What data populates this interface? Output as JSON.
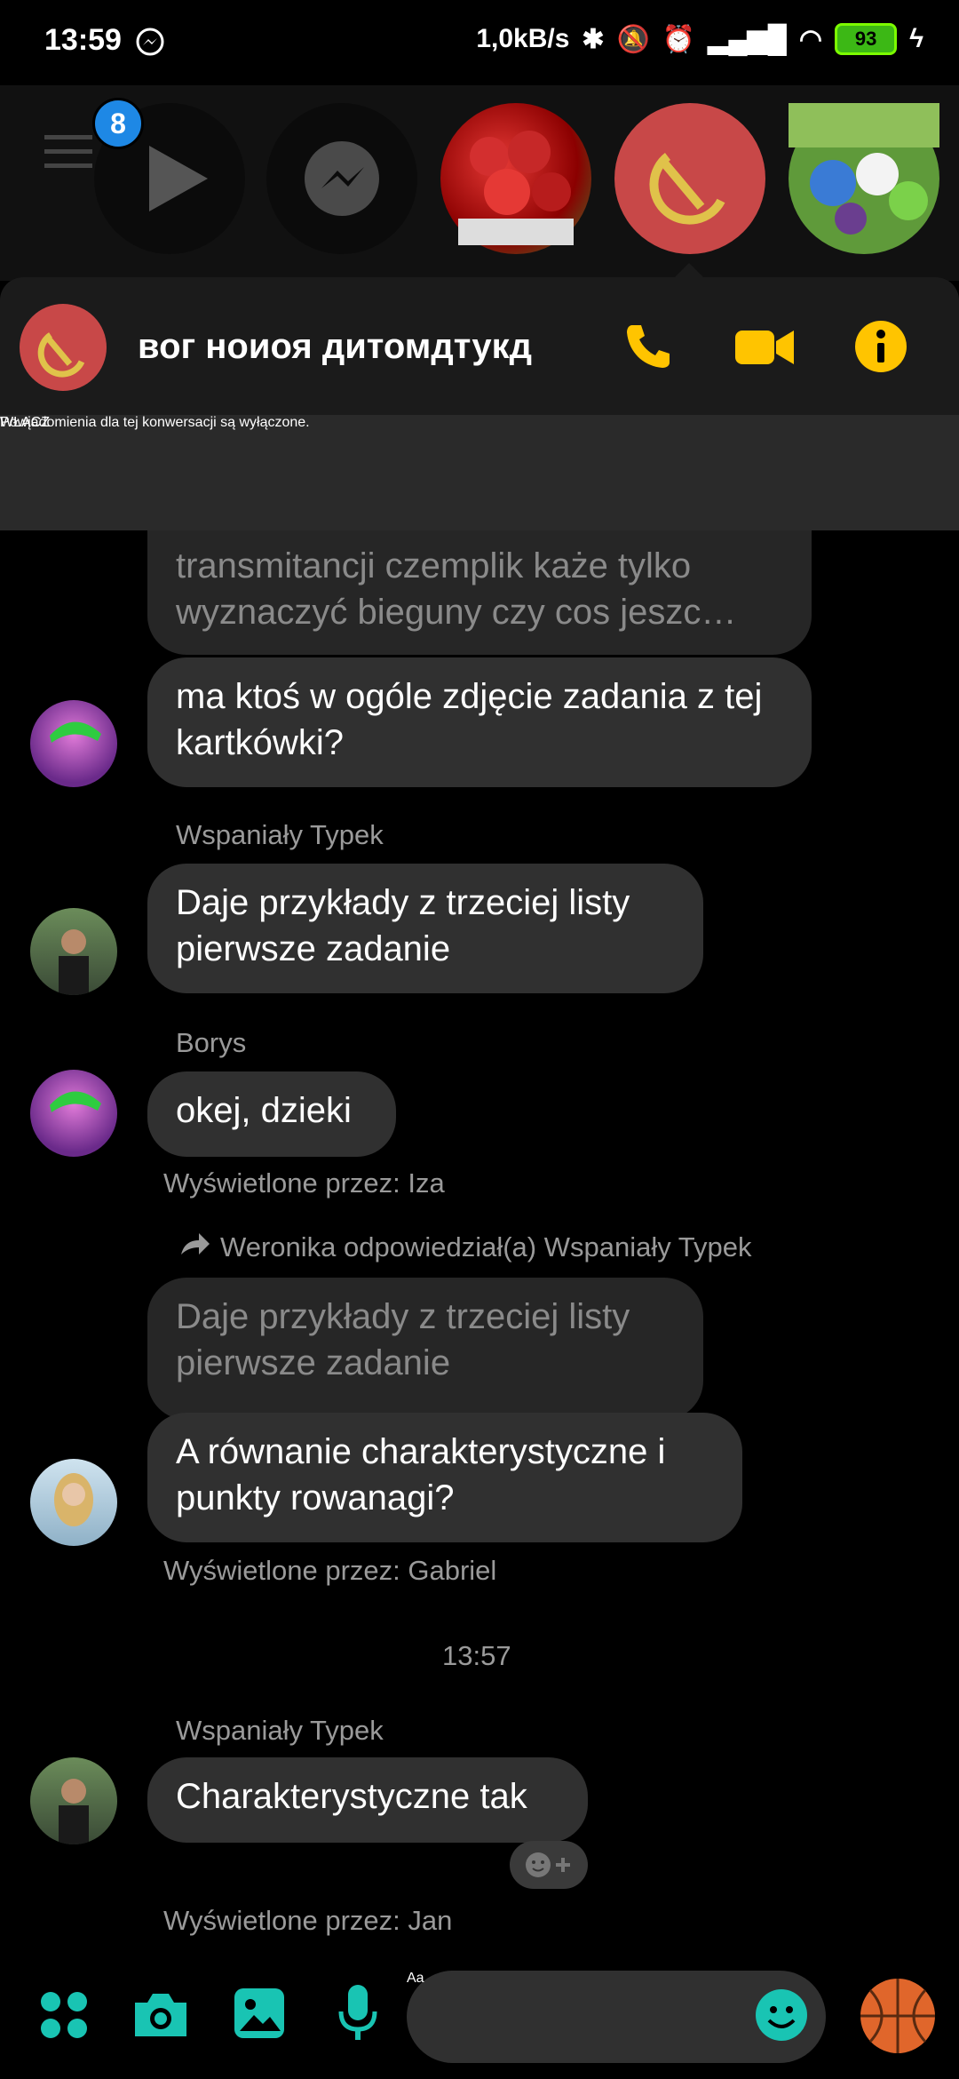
{
  "status_bar": {
    "time": "13:59",
    "net_speed": "1,0kB/s",
    "battery": "93"
  },
  "chat_heads": {
    "badge_count": "8"
  },
  "conversation": {
    "title": "вог ноиоя дитомдтукд"
  },
  "notice": {
    "text": "Powiadomienia dla tej konwersacji są wyłączone.",
    "button": "WŁĄCZ"
  },
  "messages": {
    "quoted_top": "transmitancji czemplik każe tylko wyznaczyć bieguny czy cos jeszc…",
    "msg1": "ma ktoś w ogóle zdjęcie zadania z tej kartkówki?",
    "sender2": "Wspaniały Typek",
    "msg2": "Daje przykłady z trzeciej listy pierwsze zadanie",
    "sender3": "Borys",
    "msg3": "okej, dzieki",
    "seen3": "Wyświetlone przez: Iza",
    "reply_info": "Weronika odpowiedział(a) Wspaniały Typek",
    "quoted_reply": "Daje przykłady z trzeciej listy pierwsze zadanie",
    "msg4": "A równanie charakterystyczne i punkty rowanagi?",
    "seen4": "Wyświetlone przez: Gabriel",
    "timestamp": "13:57",
    "sender5": "Wspaniały Typek",
    "msg5": "Charakterystyczne tak",
    "seen5": "Wyświetlone przez: Jan"
  },
  "composer": {
    "placeholder": "Aa"
  }
}
